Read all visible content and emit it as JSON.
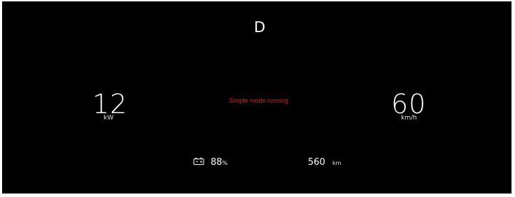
{
  "dashboard": {
    "gear": "D",
    "power": {
      "value": "12",
      "unit": "kW"
    },
    "status_message": "Simple mode running",
    "speed": {
      "value": "60",
      "unit": "km/h"
    },
    "battery": {
      "value": "88",
      "unit": "%",
      "icon": "battery-icon"
    },
    "range": {
      "value": "560",
      "unit": "km"
    }
  },
  "colors": {
    "background": "#000000",
    "text": "#ffffff",
    "status": "#c8262a"
  }
}
